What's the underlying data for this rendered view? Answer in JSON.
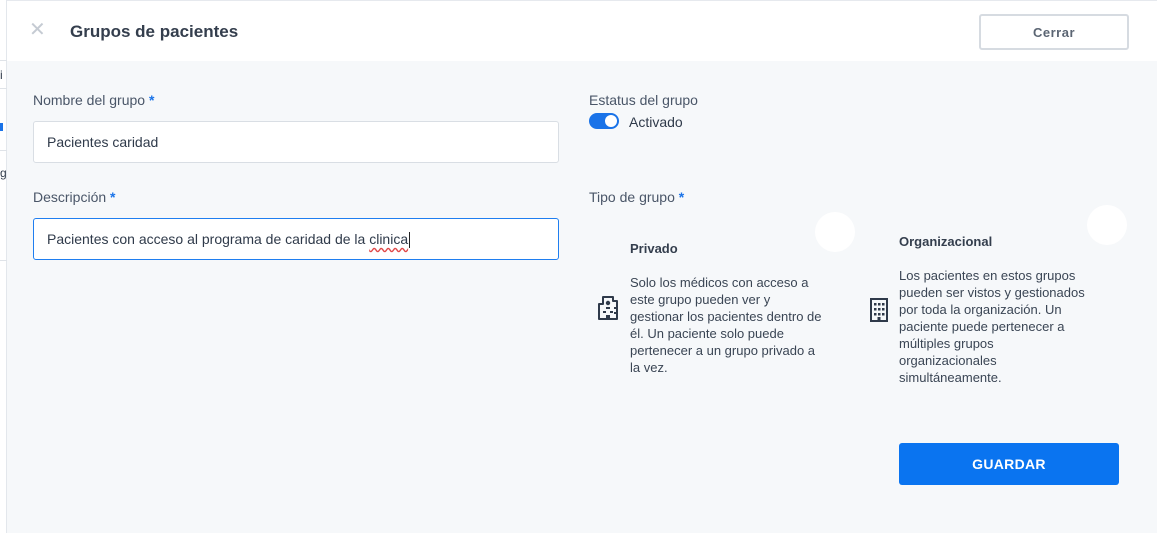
{
  "dialog": {
    "title": "Grupos de pacientes",
    "close_label": "Cerrar",
    "close_icon": "close-icon"
  },
  "form": {
    "name_label": "Nombre del grupo",
    "name_value": "Pacientes caridad",
    "description_label": "Descripción",
    "description_value_prefix": "Pacientes con acceso al programa de caridad de la ",
    "description_value_misspelled": "clinica",
    "required_mark": "*",
    "status_label": "Estatus del grupo",
    "status_value": "Activado",
    "type_label": "Tipo de grupo"
  },
  "group_types": {
    "private": {
      "title": "Privado",
      "description": "Solo los médicos con acceso a este grupo pueden ver y gestionar los pacientes dentro de él. Un paciente solo puede pertenecer a un grupo privado a la vez.",
      "icon": "private-building-icon"
    },
    "organizational": {
      "title": "Organizacional",
      "description": "Los pacientes en estos grupos pueden ser vistos y gestionados por toda la organización. Un paciente puede pertenecer a múltiples grupos organizacionales simultáneamente.",
      "icon": "building-icon"
    }
  },
  "actions": {
    "save_label": "GUARDAR"
  },
  "background_fragments": [
    "i",
    "g"
  ],
  "colors": {
    "accent": "#0a74f0",
    "toggle_on": "#1a73e8",
    "background": "#f6f8fa"
  }
}
